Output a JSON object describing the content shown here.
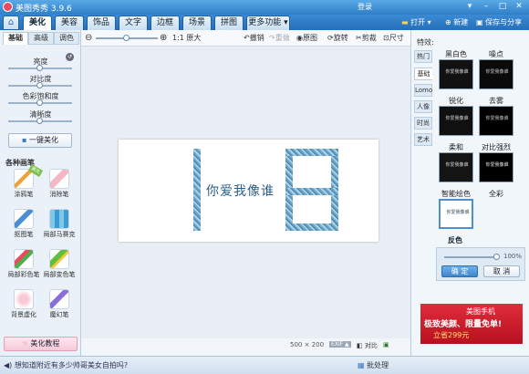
{
  "window": {
    "title": "美图秀秀 3.9.6",
    "login": "登录",
    "controls": [
      "▾",
      "–",
      "□",
      "✕"
    ]
  },
  "nav": {
    "home_icon": "home-icon",
    "tabs": [
      "美化",
      "美容",
      "饰品",
      "文字",
      "边框",
      "场景",
      "拼图",
      "更多功能 ▾"
    ],
    "active_tab": "美化",
    "open_label": "打开 ▾",
    "new_label": "新建",
    "save_label": "保存与分享"
  },
  "left": {
    "tabs": [
      "基础",
      "高级",
      "调色"
    ],
    "sliders": [
      {
        "label": "亮度",
        "value": 0.5
      },
      {
        "label": "对比度",
        "value": 0.5
      },
      {
        "label": "色彩饱和度",
        "value": 0.5
      },
      {
        "label": "清晰度",
        "value": 0.5
      }
    ],
    "one_click_label": "一键美化",
    "brushes_title": "各种画笔",
    "brushes": [
      {
        "label": "涂鸦笔",
        "icon": "pen-icon",
        "badge": "美化"
      },
      {
        "label": "消除笔",
        "icon": "eraser-icon"
      },
      {
        "label": "抠图笔",
        "icon": "cutout-pen-icon"
      },
      {
        "label": "局部马赛克",
        "icon": "mosaic-icon"
      },
      {
        "label": "局部彩色笔",
        "icon": "color-pen-icon"
      },
      {
        "label": "局部变色笔",
        "icon": "recolor-pen-icon"
      },
      {
        "label": "背景虚化",
        "icon": "blur-icon"
      },
      {
        "label": "魔幻笔",
        "icon": "magic-pen-icon"
      }
    ],
    "tutorial_label": "美化教程"
  },
  "toolbar": {
    "zoom_out": "⊖",
    "zoom_in": "⊕",
    "zoom_value": 0.5,
    "actual_size": "1:1 原大",
    "undo": "撤销",
    "redo": "重做",
    "original": "原图",
    "rotate": "旋转",
    "crop": "剪裁",
    "resize": "尺寸"
  },
  "canvas": {
    "image_text": "你爱我像谁"
  },
  "status": {
    "message": "想知道附近有多少帅哥美女自拍吗?",
    "dimensions": "500 × 200",
    "exif": "EXIF ▲",
    "compare": "对比",
    "batch": "批处理"
  },
  "right": {
    "effects_title": "特效:",
    "tabs": [
      "热门",
      "基础",
      "Lomo",
      "人像",
      "时尚",
      "艺术"
    ],
    "active_tab": "基础",
    "effects": [
      {
        "label": "黑白色"
      },
      {
        "label": "噪点"
      },
      {
        "label": "锐化"
      },
      {
        "label": "去雾"
      },
      {
        "label": "柔和"
      },
      {
        "label": "对比强烈"
      },
      {
        "label": "智能绘色"
      },
      {
        "label": "全彩"
      }
    ],
    "thumb_text": "你爱我像谁",
    "selected_effect": "反色",
    "opacity": {
      "value": 1.0,
      "display": "100%"
    },
    "ok_label": "确 定",
    "cancel_label": "取 消",
    "ad": {
      "brand": "美图手机",
      "line1": "极致美颜、限量免单!",
      "line2": "立省299元"
    }
  }
}
